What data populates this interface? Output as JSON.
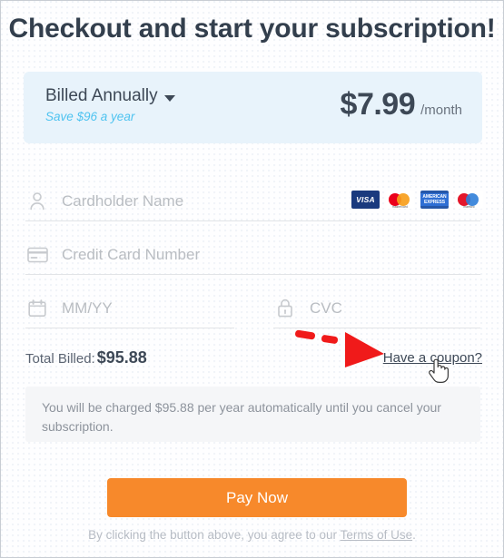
{
  "header": {
    "title": "Checkout and start your subscription!"
  },
  "pricing": {
    "plan_label": "Billed Annually",
    "plan_caret_icon": "chevron-down-icon",
    "save_note": "Save $96 a year",
    "price_amount": "$7.99",
    "price_period": "/month"
  },
  "form": {
    "cardholder": {
      "placeholder": "Cardholder Name",
      "value": "",
      "icon": "user-icon"
    },
    "card_number": {
      "placeholder": "Credit Card Number",
      "value": "",
      "icon": "credit-card-icon"
    },
    "expiry": {
      "placeholder": "MM/YY",
      "value": "",
      "icon": "calendar-icon"
    },
    "cvc": {
      "placeholder": "CVC",
      "value": "",
      "icon": "lock-icon"
    },
    "card_logos": [
      {
        "name": "visa-logo",
        "text": "VISA"
      },
      {
        "name": "mastercard-logo",
        "text": "mastercard"
      },
      {
        "name": "amex-logo",
        "text": "AMERICAN EXPRESS"
      },
      {
        "name": "maestro-logo",
        "text": "maestro"
      }
    ]
  },
  "totals": {
    "label": "Total Billed:",
    "amount": "$95.88",
    "coupon_link": "Have a coupon?"
  },
  "annotation": {
    "arrow": "red-dashed-arrow",
    "cursor": "pointing-hand-cursor"
  },
  "disclaimer": {
    "text": "You will be charged $95.88 per year automatically until you cancel your subscription."
  },
  "footer": {
    "pay_button": "Pay Now",
    "terms_prefix": "By clicking the button above, you agree to our ",
    "terms_link": "Terms of Use",
    "terms_suffix": "."
  },
  "colors": {
    "accent_orange": "#f7892b",
    "band_blue": "#e8f3fb",
    "save_blue": "#4ec3f0",
    "annotation_red": "#f01a1a",
    "text_dark": "#3d4856"
  }
}
